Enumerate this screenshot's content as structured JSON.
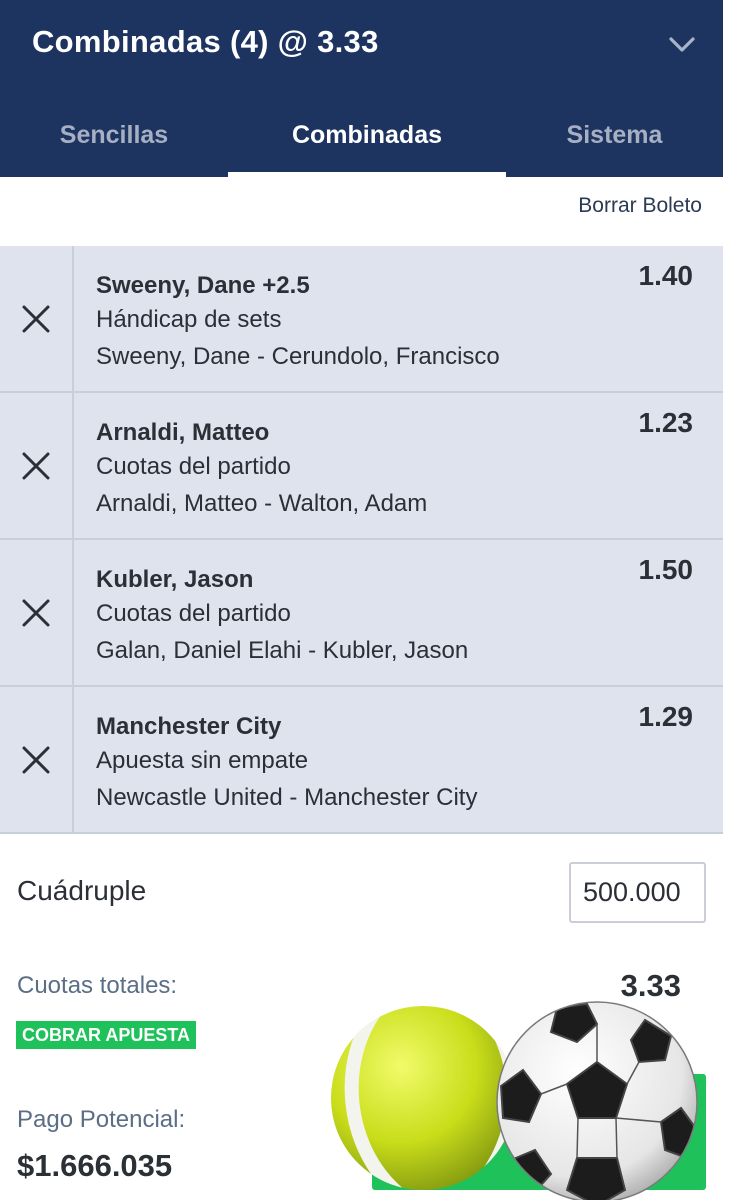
{
  "header": {
    "title": "Combinadas (4) @ 3.33"
  },
  "tabs": [
    {
      "label": "Sencillas",
      "active": false
    },
    {
      "label": "Combinadas",
      "active": true
    },
    {
      "label": "Sistema",
      "active": false
    }
  ],
  "clear_label": "Borrar Boleto",
  "selections": [
    {
      "name": "Sweeny, Dane +2.5",
      "market": "Hándicap de sets",
      "event": "Sweeny, Dane - Cerundolo, Francisco",
      "odds": "1.40"
    },
    {
      "name": "Arnaldi, Matteo",
      "market": "Cuotas del partido",
      "event": "Arnaldi, Matteo - Walton, Adam",
      "odds": "1.23"
    },
    {
      "name": "Kubler, Jason",
      "market": "Cuotas del partido",
      "event": "Galan, Daniel Elahi - Kubler, Jason",
      "odds": "1.50"
    },
    {
      "name": "Manchester City",
      "market": "Apuesta sin empate",
      "event": "Newcastle United - Manchester City",
      "odds": "1.29"
    }
  ],
  "stake": {
    "label": "Cuádruple",
    "value": "500.000"
  },
  "totals": {
    "odds_label": "Cuotas totales:",
    "odds_value": "3.33",
    "cashout_badge": "COBRAR APUESTA",
    "payout_label": "Pago Potencial:",
    "payout_value": "$1.666.035"
  },
  "colors": {
    "header_bg": "#1d3461",
    "selection_bg": "#dee3ee",
    "accent_green": "#1fc25a",
    "muted_text": "#5a6e85"
  },
  "icons": {
    "collapse": "chevron-down-icon",
    "remove": "close-icon",
    "tennis": "tennis-ball-icon",
    "soccer": "soccer-ball-icon"
  }
}
